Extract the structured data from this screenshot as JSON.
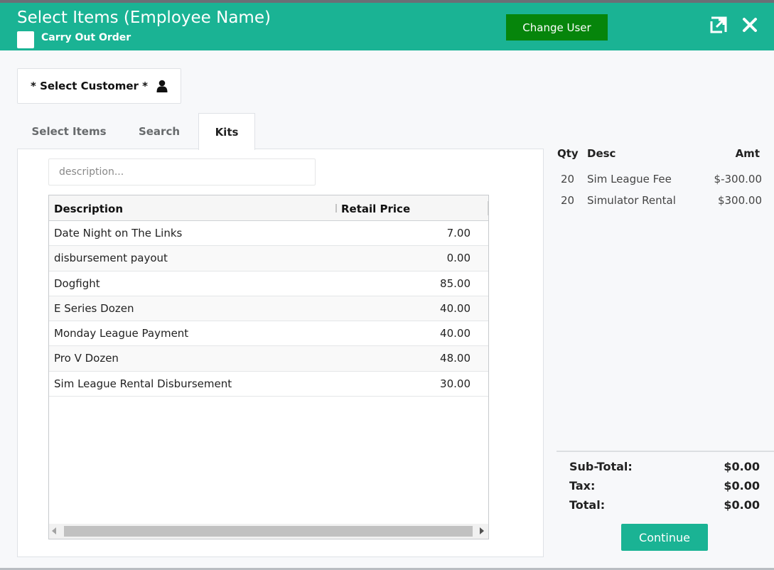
{
  "header": {
    "title": "Select Items (Employee Name)",
    "carry_out_label": "Carry Out Order",
    "carry_out_checked": false,
    "change_user_label": "Change User",
    "icons": [
      "expand-icon",
      "close-icon"
    ]
  },
  "customer": {
    "select_label": "* Select Customer *",
    "icon": "user-icon"
  },
  "tabs": [
    {
      "label": "Select Items",
      "active": false
    },
    {
      "label": "Search",
      "active": false
    },
    {
      "label": "Kits",
      "active": true
    }
  ],
  "search": {
    "placeholder": "description...",
    "value": ""
  },
  "grid": {
    "columns": [
      "Description",
      "Retail Price"
    ],
    "rows": [
      {
        "description": "Date Night on The Links",
        "price": "7.00"
      },
      {
        "description": "disbursement payout",
        "price": "0.00"
      },
      {
        "description": "Dogfight",
        "price": "85.00"
      },
      {
        "description": "E Series Dozen",
        "price": "40.00"
      },
      {
        "description": "Monday League Payment",
        "price": "40.00"
      },
      {
        "description": "Pro V Dozen",
        "price": "48.00"
      },
      {
        "description": "Sim League Rental Disbursement",
        "price": "30.00"
      }
    ]
  },
  "order": {
    "columns": {
      "qty": "Qty",
      "desc": "Desc",
      "amt": "Amt"
    },
    "lines": [
      {
        "qty": "20",
        "desc": "Sim League Fee",
        "amt": "$-300.00"
      },
      {
        "qty": "20",
        "desc": "Simulator Rental",
        "amt": "$300.00"
      }
    ],
    "subtotal_label": "Sub-Total:",
    "subtotal": "$0.00",
    "tax_label": "Tax:",
    "tax": "$0.00",
    "total_label": "Total:",
    "total": "$0.00",
    "continue_label": "Continue"
  },
  "colors": {
    "accent": "#1ab394",
    "change_user": "#06850b"
  }
}
